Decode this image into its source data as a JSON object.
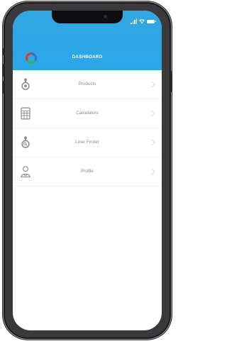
{
  "header": {
    "title": "DASHBOARD",
    "background_color": "#2aa7ea"
  },
  "logo": {
    "name": "app-logo",
    "colors": [
      "#2f73c7",
      "#36b34a",
      "#e8362b"
    ]
  },
  "status_bar": {
    "icons": [
      "signal-icon",
      "wifi-icon",
      "battery-icon"
    ]
  },
  "menu": {
    "items": [
      {
        "label": "Products",
        "icon": "products-icon"
      },
      {
        "label": "Calculators",
        "icon": "calculator-icon"
      },
      {
        "label": "Liner Finder",
        "icon": "liner-finder-icon"
      },
      {
        "label": "Profile",
        "icon": "profile-icon"
      }
    ]
  }
}
